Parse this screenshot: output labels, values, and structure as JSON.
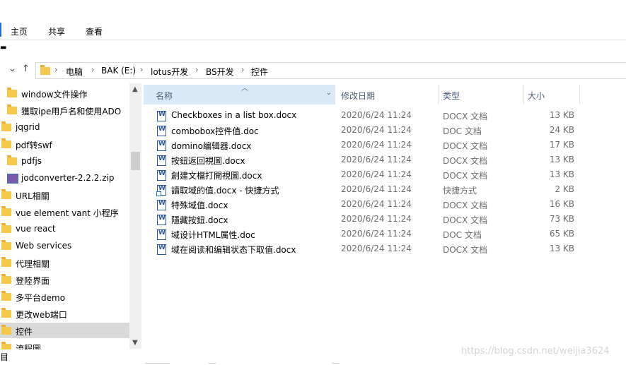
{
  "ribbon": {
    "tabs": [
      "主页",
      "共享",
      "查看"
    ]
  },
  "address": {
    "crumbs": [
      "电脑",
      "BAK (E:)",
      "lotus开发",
      "BS开发",
      "控件"
    ]
  },
  "nav": {
    "items": [
      {
        "label": "window文件操作",
        "indent": 1
      },
      {
        "label": "獲取ipe用戶名和使用ADO",
        "indent": 1
      },
      {
        "label": "jqgrid",
        "indent": 0
      },
      {
        "label": "pdf转swf",
        "indent": 0
      },
      {
        "label": "pdfjs",
        "indent": 1
      },
      {
        "label": "jodconverter-2.2.2.zip",
        "indent": 1,
        "zip": true
      },
      {
        "label": "URL相關",
        "indent": 0
      },
      {
        "label": "vue element vant 小程序",
        "indent": 0
      },
      {
        "label": "vue react",
        "indent": 0
      },
      {
        "label": "Web services",
        "indent": 0
      },
      {
        "label": "代理相關",
        "indent": 0
      },
      {
        "label": "登陸界面",
        "indent": 0
      },
      {
        "label": "多平台demo",
        "indent": 0
      },
      {
        "label": "更改web端口",
        "indent": 0
      },
      {
        "label": "控件",
        "indent": 0,
        "selected": true
      },
      {
        "label": "流程圖",
        "indent": 0
      }
    ]
  },
  "columns": {
    "name": "名称",
    "date": "修改日期",
    "type": "类型",
    "size": "大小"
  },
  "files": [
    {
      "name": "Checkboxes in a list box.docx",
      "date": "2020/6/24 11:24",
      "type": "DOCX 文档",
      "size": "13 KB"
    },
    {
      "name": "combobox控件值.doc",
      "date": "2020/6/24 11:24",
      "type": "DOC 文档",
      "size": "24 KB"
    },
    {
      "name": "domino编辑器.docx",
      "date": "2020/6/24 11:24",
      "type": "DOCX 文档",
      "size": "17 KB"
    },
    {
      "name": "按鈕返回視圖.docx",
      "date": "2020/6/24 11:24",
      "type": "DOCX 文档",
      "size": "13 KB"
    },
    {
      "name": "創建文檔打開視圖.docx",
      "date": "2020/6/24 11:24",
      "type": "DOCX 文档",
      "size": "13 KB"
    },
    {
      "name": "讀取域的值.docx - 快捷方式",
      "date": "2020/6/24 11:24",
      "type": "快捷方式",
      "size": "2 KB",
      "shortcut": true
    },
    {
      "name": "特殊域值.docx",
      "date": "2020/6/24 11:24",
      "type": "DOCX 文档",
      "size": "16 KB"
    },
    {
      "name": "隱藏按鈕.docx",
      "date": "2020/6/24 11:24",
      "type": "DOCX 文档",
      "size": "73 KB"
    },
    {
      "name": "域设计HTML属性.doc",
      "date": "2020/6/24 11:24",
      "type": "DOC 文档",
      "size": "65 KB"
    },
    {
      "name": "域在阅读和编辑状态下取值.docx",
      "date": "2020/6/24 11:24",
      "type": "DOCX 文档",
      "size": "13 KB"
    }
  ],
  "status": {
    "text": "目"
  },
  "watermark": "https://blog.csdn.net/weijia3624"
}
